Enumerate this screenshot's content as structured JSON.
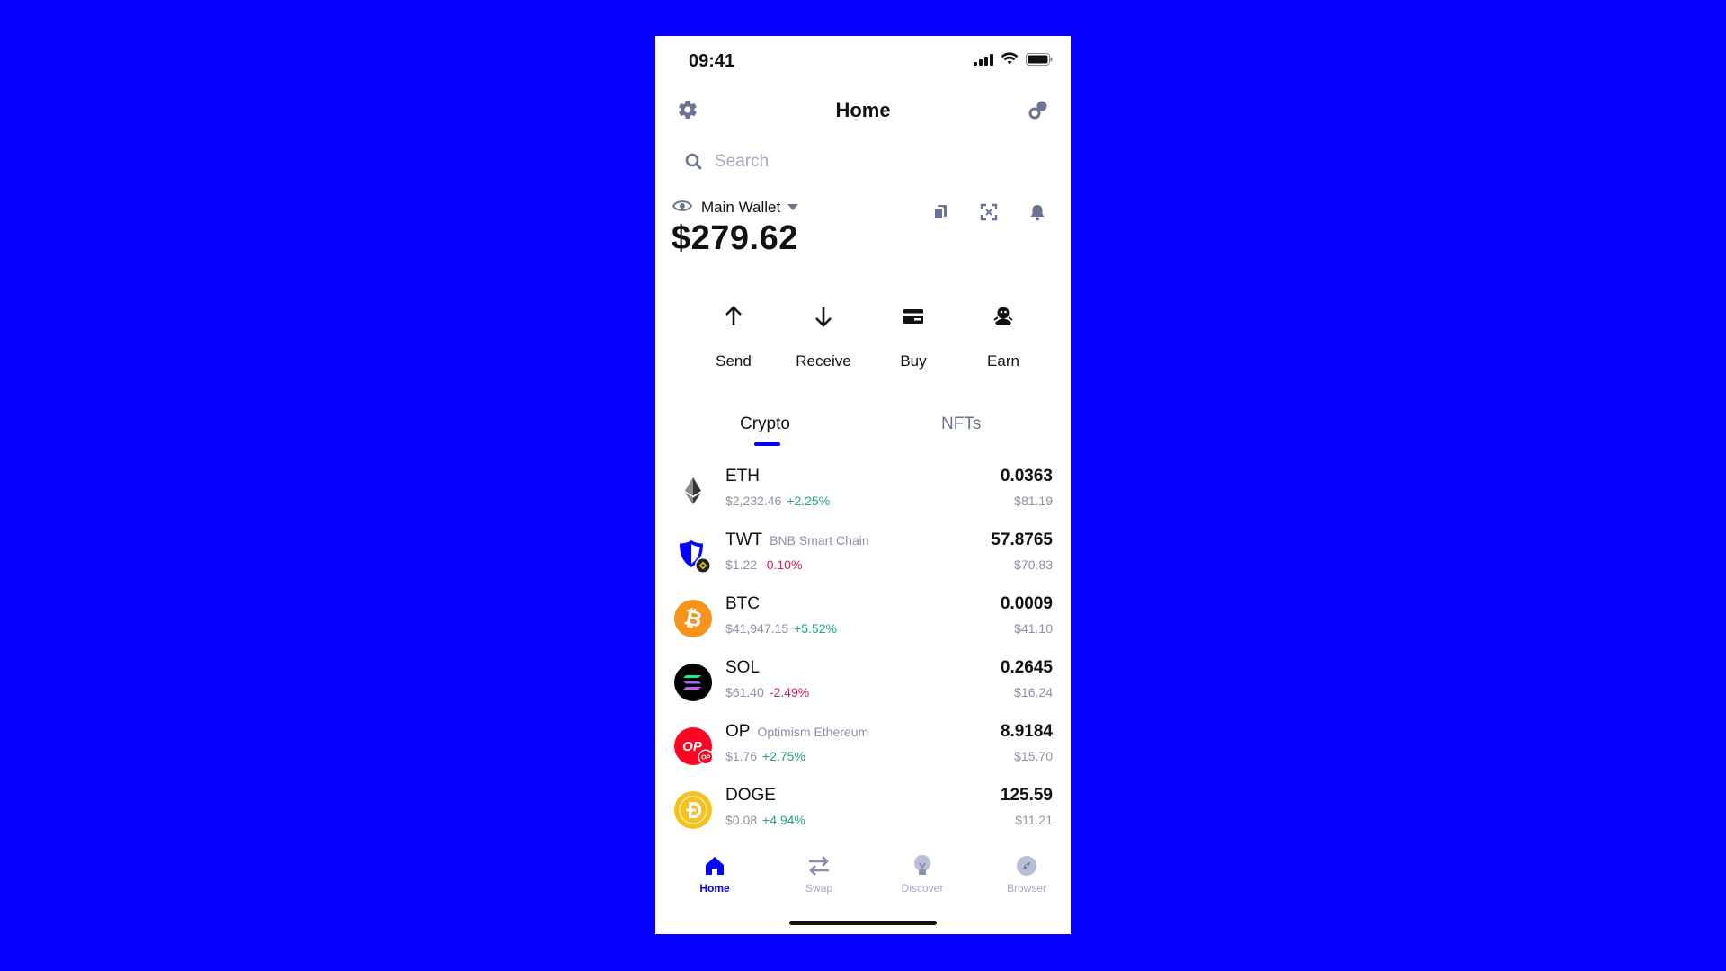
{
  "status_bar": {
    "time": "09:41"
  },
  "header": {
    "title": "Home"
  },
  "search": {
    "placeholder": "Search"
  },
  "wallet": {
    "name": "Main Wallet",
    "balance": "$279.62"
  },
  "actions": [
    {
      "label": "Send",
      "icon": "arrow-up-icon"
    },
    {
      "label": "Receive",
      "icon": "arrow-down-icon"
    },
    {
      "label": "Buy",
      "icon": "card-icon"
    },
    {
      "label": "Earn",
      "icon": "piggy-icon"
    }
  ],
  "tabs": {
    "crypto": "Crypto",
    "nfts": "NFTs",
    "active": "Crypto"
  },
  "assets": [
    {
      "symbol": "ETH",
      "chain": "",
      "price": "$2,232.46",
      "change": "+2.25%",
      "amount": "0.0363",
      "value": "$81.19"
    },
    {
      "symbol": "TWT",
      "chain": "BNB Smart Chain",
      "price": "$1.22",
      "change": "-0.10%",
      "amount": "57.8765",
      "value": "$70.83"
    },
    {
      "symbol": "BTC",
      "chain": "",
      "price": "$41,947.15",
      "change": "+5.52%",
      "amount": "0.0009",
      "value": "$41.10"
    },
    {
      "symbol": "SOL",
      "chain": "",
      "price": "$61.40",
      "change": "-2.49%",
      "amount": "0.2645",
      "value": "$16.24"
    },
    {
      "symbol": "OP",
      "chain": "Optimism Ethereum",
      "price": "$1.76",
      "change": "+2.75%",
      "amount": "8.9184",
      "value": "$15.70"
    },
    {
      "symbol": "DOGE",
      "chain": "",
      "price": "$0.08",
      "change": "+4.94%",
      "amount": "125.59",
      "value": "$11.21"
    }
  ],
  "logos": {
    "op_main": "OP",
    "op_badge": "OP"
  },
  "nav": {
    "home": "Home",
    "swap": "Swap",
    "discover": "Discover",
    "browser": "Browser"
  },
  "colors": {
    "accent": "#0500FF",
    "positive": "#1fa673",
    "negative": "#d6224f",
    "background": "#0500FF"
  }
}
